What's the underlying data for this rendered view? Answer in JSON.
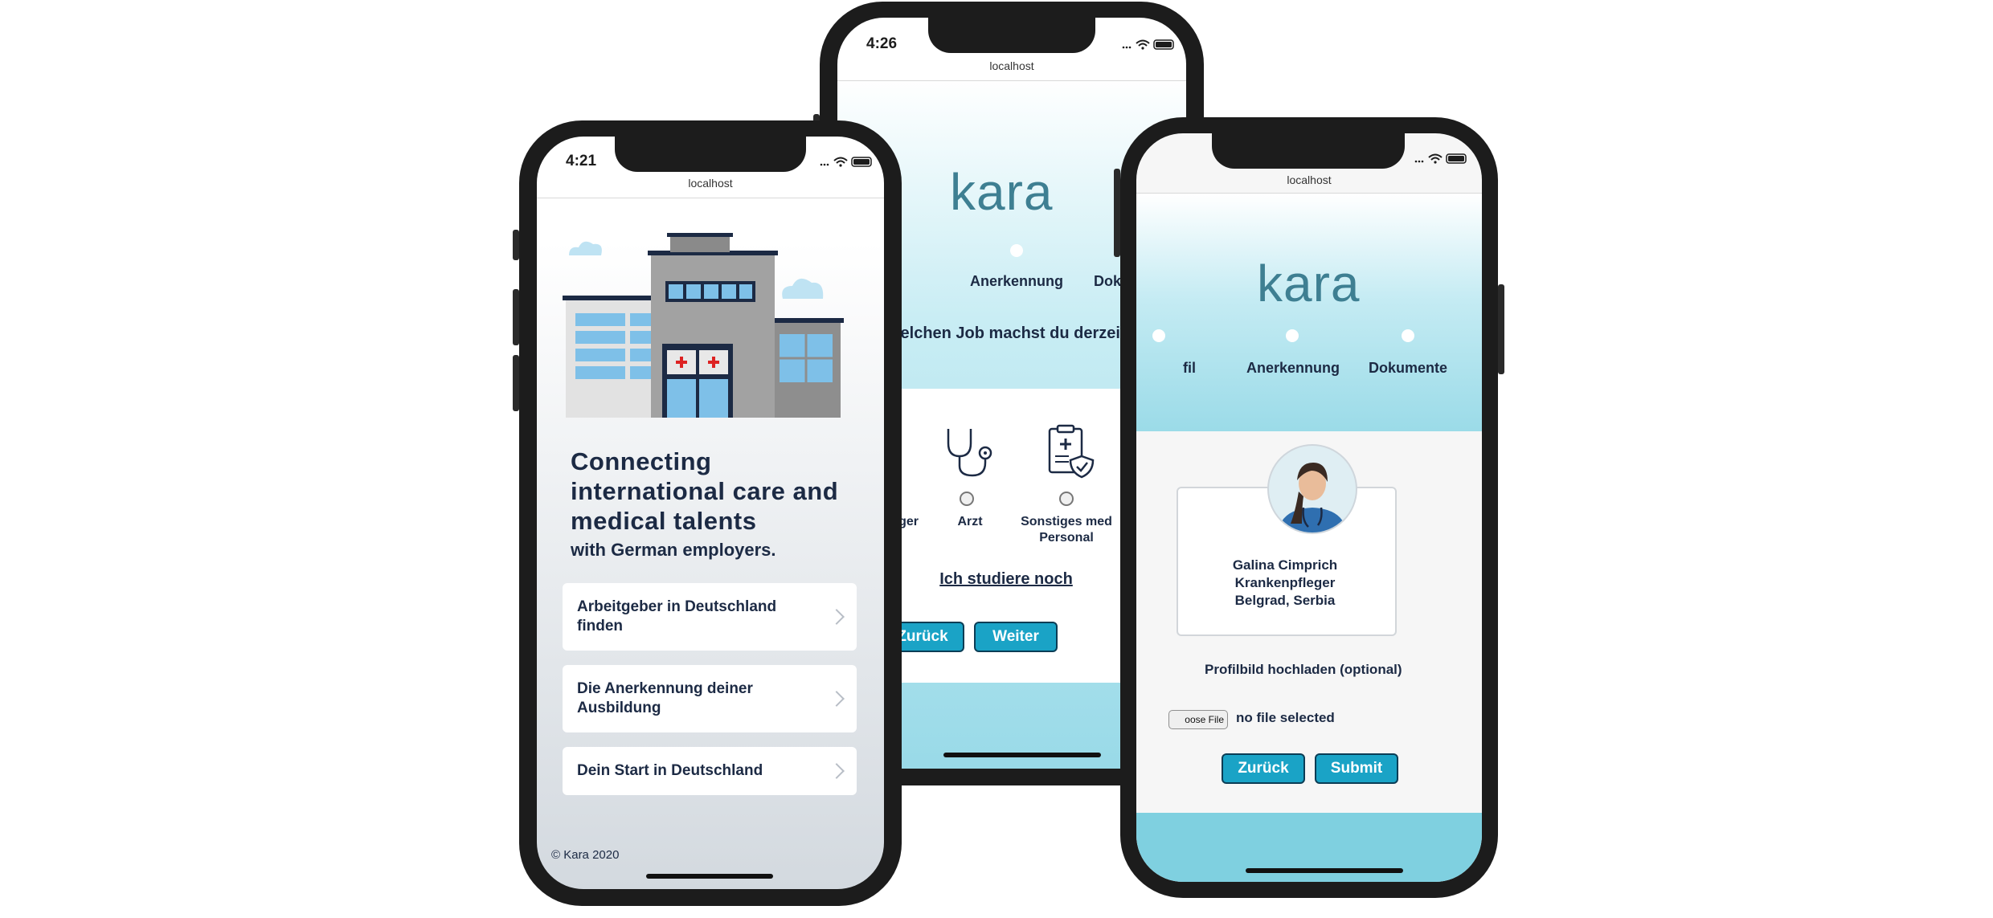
{
  "brand": {
    "logo_text": "kara"
  },
  "phone_left": {
    "status_time": "4:21",
    "url": "localhost",
    "headline": "Connecting international care and medical talents",
    "subline": "with German employers.",
    "menu": [
      {
        "label": "Arbeitgeber in Deutschland finden"
      },
      {
        "label": "Die Anerkennung deiner Ausbildung"
      },
      {
        "label": "Dein Start in Deutschland"
      }
    ],
    "footer": "© Kara 2020"
  },
  "phone_middle": {
    "status_time": "4:26",
    "url": "localhost",
    "steps": [
      "fil",
      "Anerkennung",
      "Dokumente"
    ],
    "question": "Welchen Job machst du derzeit?",
    "jobs": [
      "enpfleger",
      "Arzt",
      "Sonstiges med Personal"
    ],
    "student_link": "Ich studiere noch",
    "back_button": "Zurück",
    "next_button": "Weiter"
  },
  "phone_right": {
    "url": "localhost",
    "steps": [
      "fil",
      "Anerkennung",
      "Dokumente"
    ],
    "profile": {
      "name": "Galina Cimprich",
      "role": "Krankenpfleger",
      "location": "Belgrad, Serbia"
    },
    "upload_label": "Profilbild hochladen (optional)",
    "file_button": "oose File",
    "file_status": "no file selected",
    "back_button": "Zurück",
    "submit_button": "Submit"
  },
  "colors": {
    "accent": "#1aa3c6",
    "teal_bg": "#7fd0e0",
    "text_dark": "#1c2a44",
    "logo": "#3e7f92"
  }
}
